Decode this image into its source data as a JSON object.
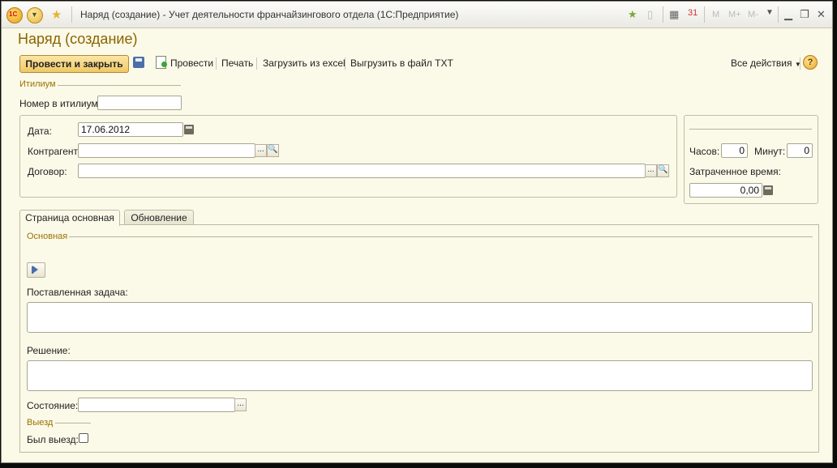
{
  "window": {
    "title": "Наряд (создание) - Учет деятельности франчайзингового отдела  (1С:Предприятие)",
    "logo_text": "1С",
    "title_buttons": [
      "M",
      "M+",
      "M-"
    ]
  },
  "form": {
    "title": "Наряд (создание)"
  },
  "toolbar": {
    "post_close": "Провести и закрыть",
    "post": "Провести",
    "print": "Печать",
    "load_excel": "Загрузить из excel",
    "export_txt": "Выгрузить в файл TXT",
    "all_actions": "Все действия",
    "help": "?"
  },
  "itilium": {
    "group_title": "Итилиум",
    "number_label": "Номер в итилиум:",
    "number_value": ""
  },
  "header": {
    "date_label": "Дата:",
    "date_value": "17.06.2012",
    "counterparty_label": "Контрагент:",
    "counterparty_value": "",
    "contract_label": "Договор:",
    "contract_value": "",
    "ellipsis": "..."
  },
  "time": {
    "hours_label": "Часов:",
    "hours_value": "0",
    "minutes_label": "Минут:",
    "minutes_value": "0",
    "spent_label": "Затраченное время:",
    "spent_value": "0,00"
  },
  "tabs": [
    {
      "label": "Страница основная",
      "active": true
    },
    {
      "label": "Обновление",
      "active": false
    }
  ],
  "main_tab": {
    "group_title": "Основная",
    "task_label": "Поставленная задача:",
    "task_value": "",
    "solution_label": "Решение:",
    "solution_value": "",
    "state_label": "Состояние:",
    "state_value": "",
    "trip_group_title": "Выезд",
    "trip_label": "Был выезд:",
    "trip_checked": false
  }
}
